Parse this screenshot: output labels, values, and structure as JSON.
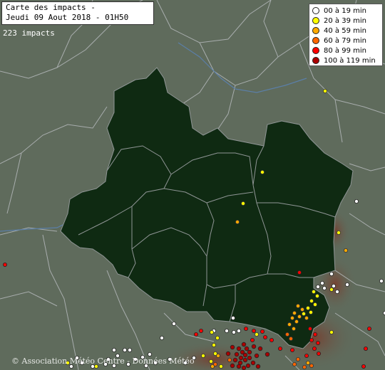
{
  "title": {
    "line1": "Carte des impacts -",
    "line2": "Jeudi 09 Aout 2018 - 01H50"
  },
  "impact_count": "223 impacts",
  "legend": {
    "items": [
      {
        "label": "00 à 19 min",
        "color": "#ffffff"
      },
      {
        "label": "20 à 39 min",
        "color": "#ffff00"
      },
      {
        "label": "40 à 59 min",
        "color": "#ffaa00"
      },
      {
        "label": "60 à 79 min",
        "color": "#ff6600"
      },
      {
        "label": "80 à 99 min",
        "color": "#ff0000"
      },
      {
        "label": "100 à 119 min",
        "color": "#aa0000"
      }
    ]
  },
  "credit": "© Association Météo Centre - Données Météo",
  "colors": {
    "background": "#5f6b5c",
    "region_fill": "#0f2a12",
    "border": "#9aa0a0",
    "river": "#5b7fa8"
  }
}
